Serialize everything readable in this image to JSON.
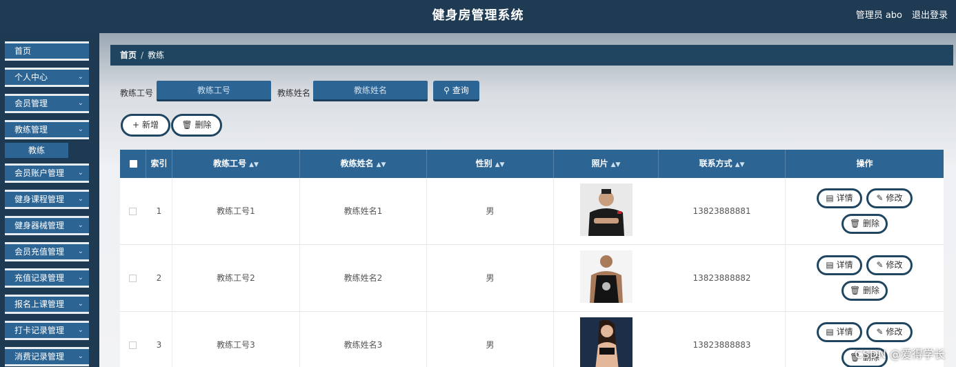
{
  "header": {
    "title": "健身房管理系统",
    "user": "管理员 abo",
    "logout": "退出登录"
  },
  "sidebar": {
    "items": [
      {
        "label": "首页",
        "chevron": false
      },
      {
        "label": "个人中心",
        "chevron": true
      },
      {
        "label": "会员管理",
        "chevron": true
      },
      {
        "label": "教练管理",
        "chevron": true
      },
      {
        "label": "会员账户管理",
        "chevron": true
      },
      {
        "label": "健身课程管理",
        "chevron": true
      },
      {
        "label": "健身器械管理",
        "chevron": true
      },
      {
        "label": "会员充值管理",
        "chevron": true
      },
      {
        "label": "充值记录管理",
        "chevron": true
      },
      {
        "label": "报名上课管理",
        "chevron": true
      },
      {
        "label": "打卡记录管理",
        "chevron": true
      },
      {
        "label": "消费记录管理",
        "chevron": true
      }
    ],
    "submenu": {
      "label": "教练"
    }
  },
  "breadcrumb": {
    "home": "首页",
    "sep": "/",
    "current": "教练"
  },
  "search": {
    "id_label": "教练工号",
    "id_placeholder": "教练工号",
    "name_label": "教练姓名",
    "name_placeholder": "教练姓名",
    "query": "查询"
  },
  "actions": {
    "add": "新增",
    "delete": "删除"
  },
  "table": {
    "headers": [
      "索引",
      "教练工号",
      "教练姓名",
      "性别",
      "照片",
      "联系方式",
      "操作"
    ],
    "rows": [
      {
        "index": "1",
        "id": "教练工号1",
        "name": "教练姓名1",
        "gender": "男",
        "phone": "13823888881"
      },
      {
        "index": "2",
        "id": "教练工号2",
        "name": "教练姓名2",
        "gender": "男",
        "phone": "13823888882"
      },
      {
        "index": "3",
        "id": "教练工号3",
        "name": "教练姓名3",
        "gender": "男",
        "phone": "13823888883"
      }
    ],
    "row_actions": {
      "detail": "详情",
      "edit": "修改",
      "delete": "删除"
    }
  },
  "watermark": "CSDN @爱得学长",
  "colors": {
    "primary": "#2c6494",
    "dark": "#1f3a53",
    "breadcrumb": "#1f4560"
  },
  "icons": {
    "chevron": "chevron-down-icon",
    "search": "search-icon",
    "plus": "plus-icon",
    "trash": "trash-icon",
    "doc": "document-icon",
    "edit": "edit-icon",
    "sort": "sort-icon"
  }
}
